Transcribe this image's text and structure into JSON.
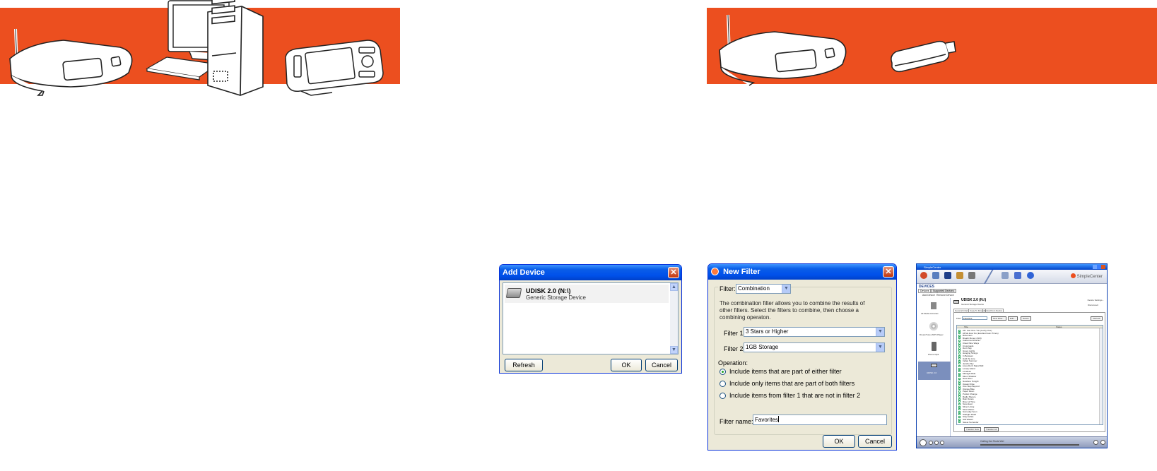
{
  "add_device": {
    "title": "Add Device",
    "device_name": "UDISK 2.0 (N:\\)",
    "device_type": "Generic Storage Device",
    "refresh_label": "Refresh",
    "ok_label": "OK",
    "cancel_label": "Cancel"
  },
  "new_filter": {
    "title": "New Filter",
    "filter_label": "Filter:",
    "filter_value": "Combination",
    "description": "The combination filter allows you to combine the results of other filters. Select the filters to combine, then choose a combining operaton.",
    "filter1_label": "Filter 1:",
    "filter1_value": "3 Stars or Higher",
    "filter2_label": "Filter 2:",
    "filter2_value": "1GB Storage",
    "operation_label": "Operation:",
    "options": [
      "Include items that are part of either filter",
      "Include only items that are part of both filters",
      "Include items from filter 1 that are not in filter 2"
    ],
    "selected_option": 0,
    "filter_name_label": "Filter name:",
    "filter_name_value": "Favorites",
    "ok_label": "OK",
    "cancel_label": "Cancel"
  },
  "simplecenter": {
    "window_title": "SimpleCenter",
    "logo": "SimpleCenter",
    "section": "DEVICES",
    "tabs": [
      "Devices",
      "Supported Devices"
    ],
    "actions": [
      "Add Device",
      "Remove Device"
    ],
    "devices": [
      "All Media Libraries",
      "DreamTunes MP3 Player",
      "Phone Mp3",
      "UDISK 2.0"
    ],
    "device_name": "UDISK 2.0 (N:\\)",
    "device_type": "General Storage Device",
    "device_links": [
      "Device Settings...",
      "Disconnect"
    ],
    "inner_tabs": [
      "General Information",
      "Copy To Device",
      "Upload from Device"
    ],
    "filter_label": "Filter",
    "filter_value": "Favorites",
    "filter_buttons": [
      "New Filter...",
      "Edit...",
      "Delete"
    ],
    "refresh_label": "Refresh",
    "column_title": "Title",
    "column_status": "Status",
    "songs": [
      "All I Can Give You (Lucky One)",
      "All Me Ever Do (Everlast Feat. Prince)",
      "Bohemian",
      "Breath Money (Drill)",
      "California Dreamin'",
      "Cloud Nine Ways",
      "Crossroads",
      "Don't Sky",
      "Green Lights",
      "Hanging Strings",
      "In Between",
      "Hold the Line",
      "Indian Summer",
      "Jericho Sky",
      "Lines Don't Stand Still",
      "Lonely Island",
      "Loveless",
      "Midnight Ride",
      "Moon Shadow",
      "New River",
      "Nowhere Tonight",
      "Ocean Drive",
      "One Step Beyond",
      "Orange Blue",
      "Paper Moon",
      "Pocket Change",
      "Radio Silence",
      "Rain Dance",
      "River of Time",
      "Seventeen",
      "Silver Lining",
      "Slow Motion",
      "Someday Soon",
      "Starlight Road",
      "Stay Awhile",
      "Still Waters",
      "Sweet Surrender"
    ],
    "bottom_buttons": [
      "Transfer Now",
      "Transfer All"
    ],
    "player_status": "Calling the Shots Wel",
    "toolbar": [
      "Music",
      "Pictures",
      "Videos",
      "Playlists",
      "Devices",
      "Settings",
      "Preview",
      "Help"
    ]
  },
  "colors": {
    "banner": "#ec4f1f",
    "xp_title": "#0050ea",
    "xp_face": "#ece9d8"
  }
}
